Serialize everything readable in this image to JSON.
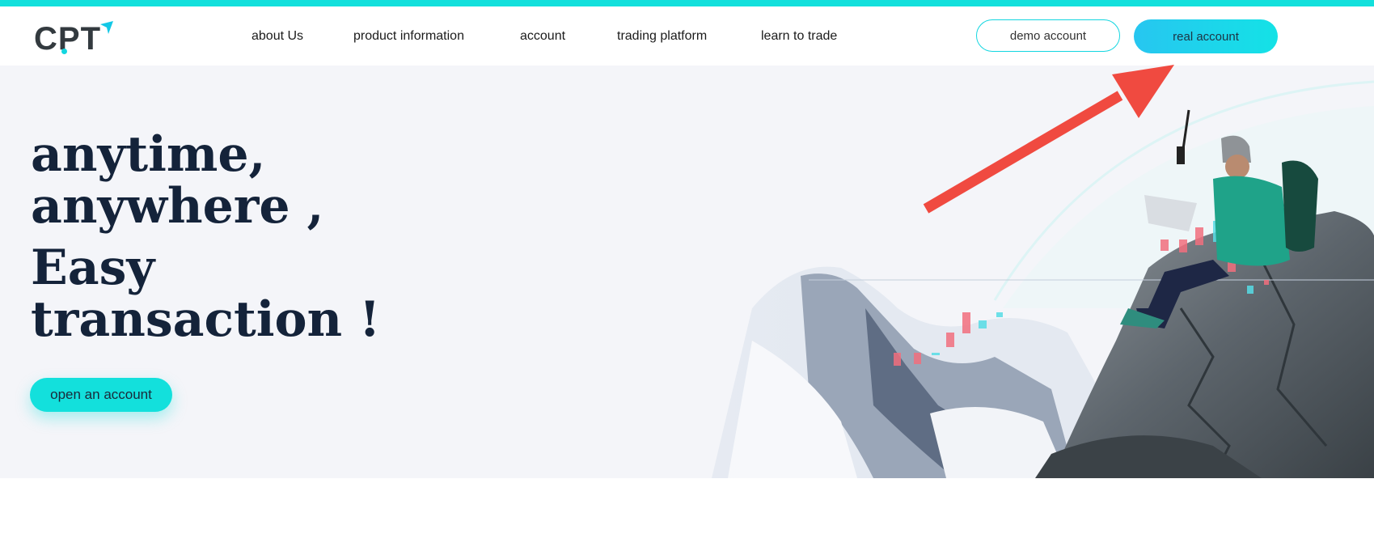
{
  "brand": {
    "logo_text": "CPT",
    "accent": "#13e0dc"
  },
  "nav": {
    "items": [
      {
        "label": "about Us"
      },
      {
        "label": "product information"
      },
      {
        "label": "account"
      },
      {
        "label": "trading platform"
      },
      {
        "label": "learn to trade"
      }
    ]
  },
  "header_buttons": {
    "demo_label": "demo account",
    "real_label": "real account"
  },
  "hero": {
    "line1": "anytime,",
    "line2": "anywhere ,",
    "line3": "Easy",
    "line4": "transaction !",
    "cta_label": "open an account"
  },
  "annotation": {
    "icon": "red-arrow-icon",
    "color": "#f04a40"
  }
}
